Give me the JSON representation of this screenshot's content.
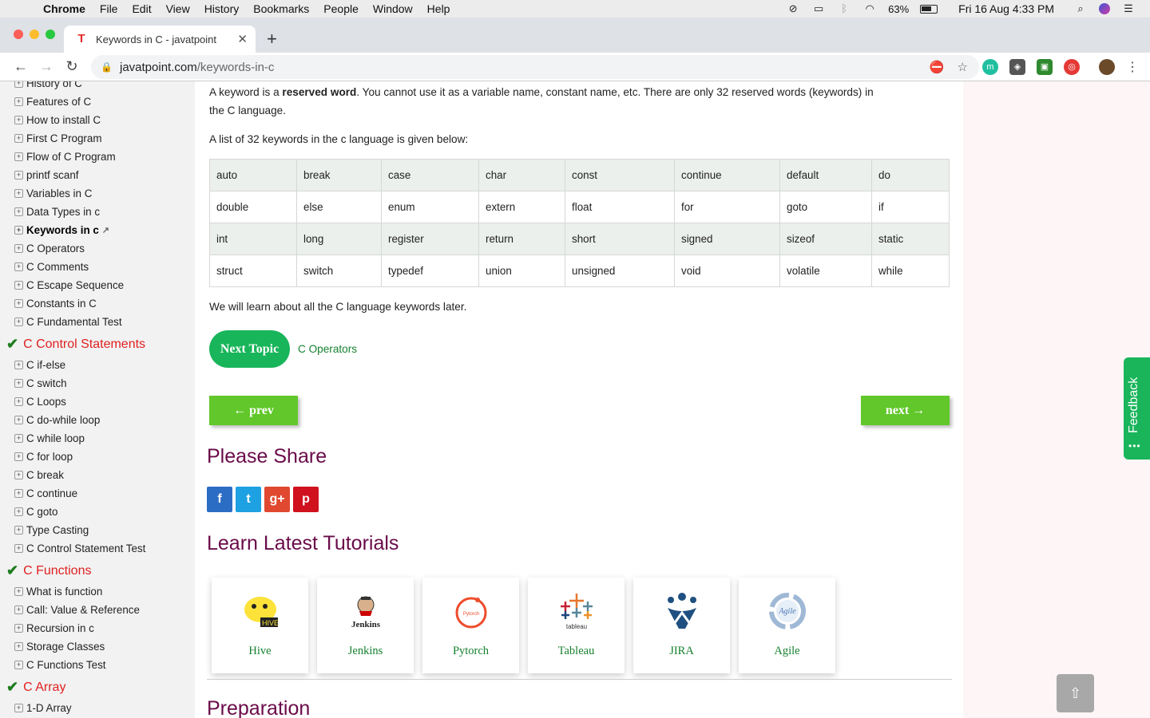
{
  "menubar": {
    "app": "Chrome",
    "items": [
      "File",
      "Edit",
      "View",
      "History",
      "Bookmarks",
      "People",
      "Window",
      "Help"
    ],
    "battery": "63%",
    "datetime": "Fri 16 Aug  4:33 PM"
  },
  "tab": {
    "title": "Keywords in C - javatpoint"
  },
  "toolbar": {
    "url_host": "javatpoint.com",
    "url_path": "/keywords-in-c"
  },
  "sidebar": {
    "group1": [
      {
        "label": "History of C"
      },
      {
        "label": "Features of C"
      },
      {
        "label": "How to install C"
      },
      {
        "label": "First C Program"
      },
      {
        "label": "Flow of C Program"
      },
      {
        "label": "printf scanf"
      },
      {
        "label": "Variables in C"
      },
      {
        "label": "Data Types in c"
      },
      {
        "label": "Keywords in c"
      },
      {
        "label": "C Operators"
      },
      {
        "label": "C Comments"
      },
      {
        "label": "C Escape Sequence"
      },
      {
        "label": "Constants in C"
      },
      {
        "label": "C Fundamental Test"
      }
    ],
    "head_control": "C Control Statements",
    "group2": [
      {
        "label": "C if-else"
      },
      {
        "label": "C switch"
      },
      {
        "label": "C Loops"
      },
      {
        "label": "C do-while loop"
      },
      {
        "label": "C while loop"
      },
      {
        "label": "C for loop"
      },
      {
        "label": "C break"
      },
      {
        "label": "C continue"
      },
      {
        "label": "C goto"
      },
      {
        "label": "Type Casting"
      },
      {
        "label": "C Control Statement Test"
      }
    ],
    "head_functions": "C Functions",
    "group3": [
      {
        "label": "What is function"
      },
      {
        "label": "Call: Value & Reference"
      },
      {
        "label": "Recursion in c"
      },
      {
        "label": "Storage Classes"
      },
      {
        "label": "C Functions Test"
      }
    ],
    "head_array": "C Array",
    "group4": [
      {
        "label": "1-D Array"
      }
    ]
  },
  "content": {
    "intro_pre": "A keyword is a ",
    "intro_bold": "reserved word",
    "intro_post": ". You cannot use it as a variable name, constant name, etc. There are only 32 reserved words (keywords) in",
    "intro_line2": "the C language.",
    "list_intro": "A list of 32 keywords in the c language is given below:",
    "keywords": [
      [
        "auto",
        "break",
        "case",
        "char",
        "const",
        "continue",
        "default",
        "do"
      ],
      [
        "double",
        "else",
        "enum",
        "extern",
        "float",
        "for",
        "goto",
        "if"
      ],
      [
        "int",
        "long",
        "register",
        "return",
        "short",
        "signed",
        "sizeof",
        "static"
      ],
      [
        "struct",
        "switch",
        "typedef",
        "union",
        "unsigned",
        "void",
        "volatile",
        "while"
      ]
    ],
    "later": "We will learn about all the C language keywords later.",
    "next_topic_label": "Next Topic",
    "next_topic_link": "C Operators",
    "prev_label": "← prev",
    "next_label": "next →",
    "share_heading": "Please Share",
    "tutorials_heading": "Learn Latest Tutorials",
    "tutorials": [
      "Hive",
      "Jenkins",
      "Pytorch",
      "Tableau",
      "JIRA",
      "Agile"
    ],
    "preparation_heading": "Preparation"
  },
  "feedback_label": "Feedback",
  "colors": {
    "accent_green": "#18b55a",
    "heading_maroon": "#6a0b49",
    "sidebar_red": "#e02020"
  }
}
